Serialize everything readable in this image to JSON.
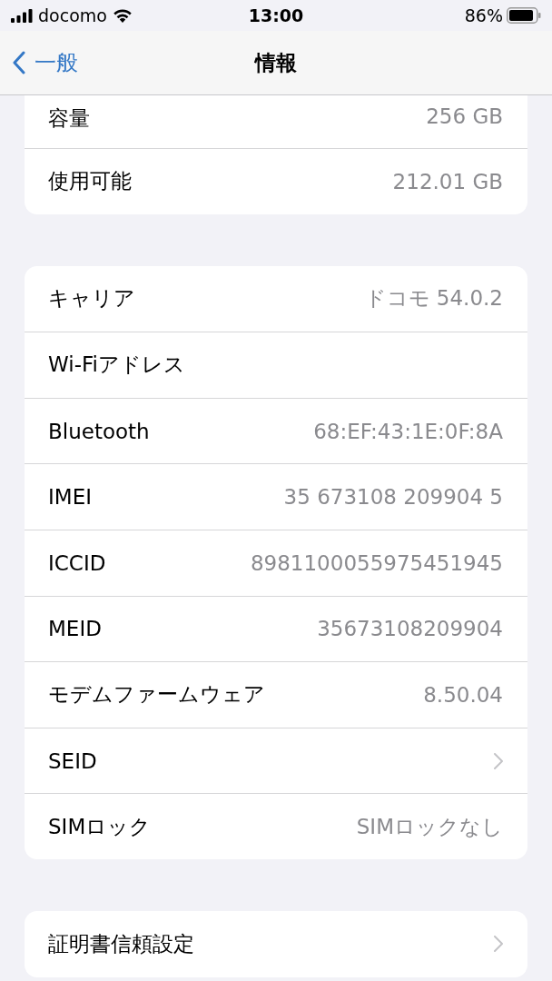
{
  "status_bar": {
    "carrier": "docomo",
    "time": "13:00",
    "battery": "86%"
  },
  "nav": {
    "back": "一般",
    "title": "情報"
  },
  "groups": [
    {
      "rows": [
        {
          "kind": "value",
          "label": "容量",
          "value": "256 GB"
        },
        {
          "kind": "value",
          "label": "使用可能",
          "value": "212.01 GB"
        }
      ]
    },
    {
      "rows": [
        {
          "kind": "value",
          "label": "キャリア",
          "value": "ドコモ 54.0.2"
        },
        {
          "kind": "value",
          "label": "Wi-Fiアドレス"
        },
        {
          "kind": "value",
          "label": "Bluetooth",
          "value": "68:EF:43:1E:0F:8A"
        },
        {
          "kind": "value",
          "label": "IMEI",
          "value": "35 673108 209904 5"
        },
        {
          "kind": "value",
          "label": "ICCID",
          "value": "8981100055975451945"
        },
        {
          "kind": "value",
          "label": "MEID",
          "value": "35673108209904"
        },
        {
          "kind": "value",
          "label": "モデムファームウェア",
          "value": "8.50.04"
        },
        {
          "kind": "link",
          "label": "SEID"
        },
        {
          "kind": "value",
          "label": "SIMロック",
          "value": "SIMロックなし"
        }
      ]
    },
    {
      "rows": [
        {
          "kind": "link",
          "label": "証明書信頼設定"
        }
      ]
    }
  ]
}
